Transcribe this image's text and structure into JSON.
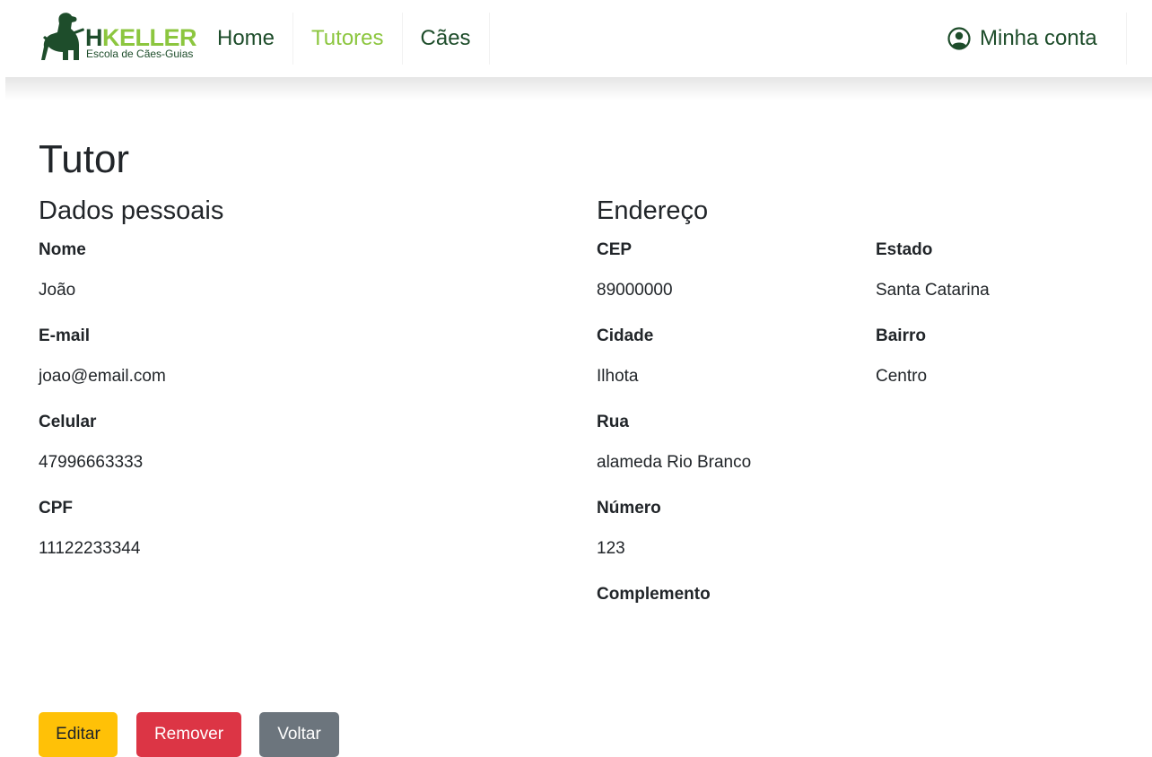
{
  "brand": {
    "name_h": "H",
    "name_rest": "KELLER",
    "subtitle": "Escola de Cães-Guias",
    "colors": {
      "dark_green": "#1e4d2b",
      "light_green": "#8cc63f"
    }
  },
  "nav": {
    "items": [
      {
        "label": "Home",
        "active": false
      },
      {
        "label": "Tutores",
        "active": true
      },
      {
        "label": "Cães",
        "active": false
      }
    ],
    "account_label": "Minha conta",
    "account_icon": "user-circle-icon"
  },
  "page": {
    "title": "Tutor"
  },
  "personal": {
    "title": "Dados pessoais",
    "nome_label": "Nome",
    "nome_value": "João",
    "email_label": "E-mail",
    "email_value": "joao@email.com",
    "celular_label": "Celular",
    "celular_value": "47996663333",
    "cpf_label": "CPF",
    "cpf_value": "11122233344"
  },
  "address": {
    "title": "Endereço",
    "cep_label": "CEP",
    "cep_value": "89000000",
    "estado_label": "Estado",
    "estado_value": "Santa Catarina",
    "cidade_label": "Cidade",
    "cidade_value": "Ilhota",
    "bairro_label": "Bairro",
    "bairro_value": "Centro",
    "rua_label": "Rua",
    "rua_value": "alameda Rio Branco",
    "numero_label": "Número",
    "numero_value": "123",
    "complemento_label": "Complemento",
    "complemento_value": ""
  },
  "actions": {
    "edit_label": "Editar",
    "remove_label": "Remover",
    "back_label": "Voltar",
    "colors": {
      "warning": "#ffc107",
      "danger": "#dc3545",
      "secondary": "#6c757d"
    }
  }
}
